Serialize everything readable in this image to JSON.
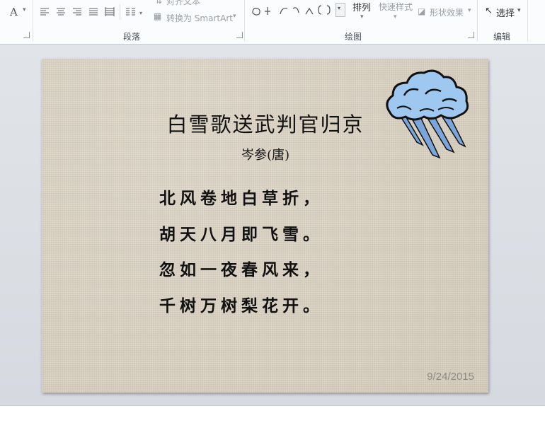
{
  "ribbon": {
    "paragraph_group_label": "段落",
    "drawing_group_label": "绘图",
    "editing_group_label": "编辑",
    "align_text_label": "对齐文本",
    "convert_smartart_label": "转换为 SmartArt",
    "arrange_label": "排列",
    "quick_styles_label": "快速样式",
    "shape_effects_label": "形状效果",
    "select_label": "选择",
    "font_color_glyph": "A"
  },
  "slide": {
    "title": "白雪歌送武判官归京",
    "author": "岑参(唐)",
    "lines": [
      "北风卷地白草折，",
      "胡天八月即飞雪。",
      "忽如一夜春风来，",
      "千树万树梨花开。"
    ],
    "date": "9/24/2015"
  },
  "colors": {
    "slide_bg": "#d8cfbd",
    "cloud_fill": "#9ec8f0",
    "rain_fill": "#7aa6dc"
  }
}
